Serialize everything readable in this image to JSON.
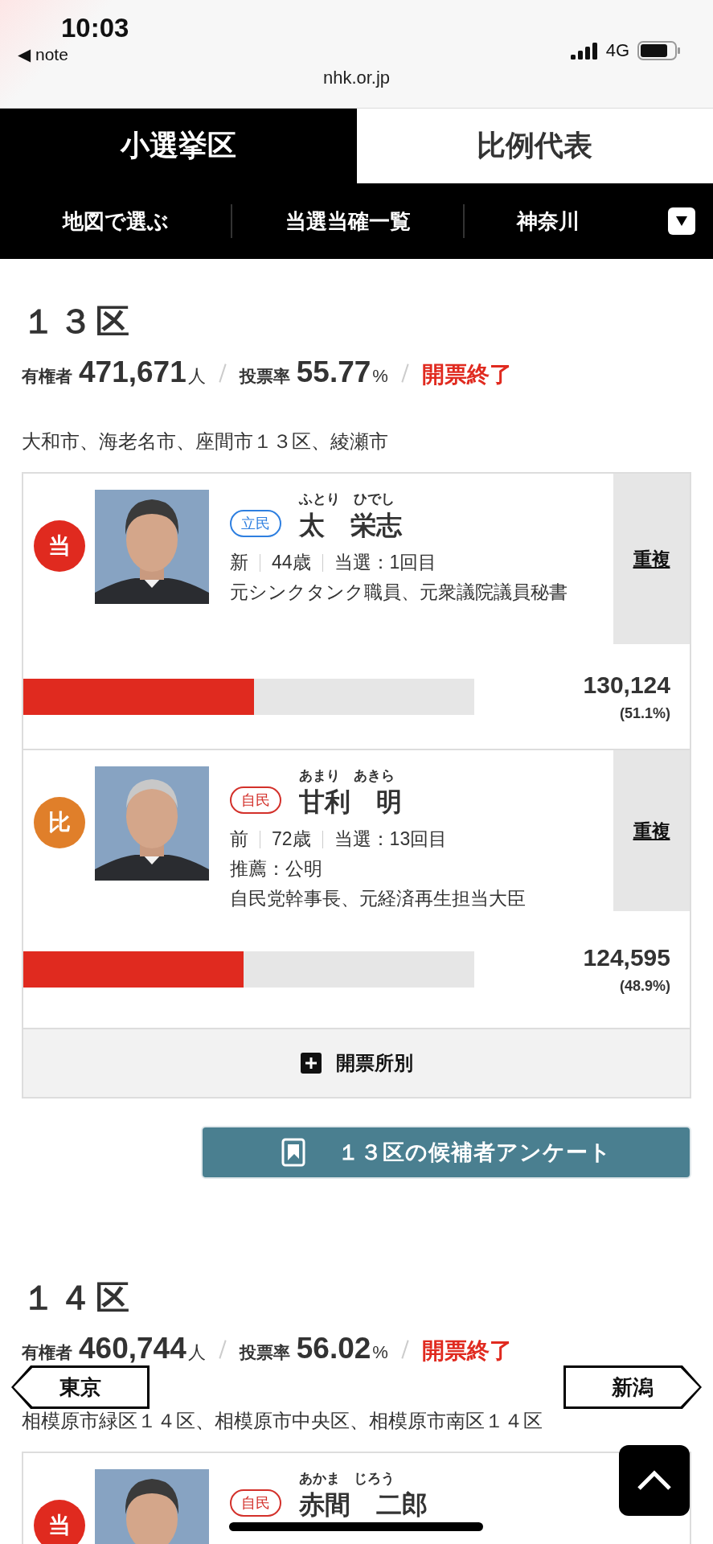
{
  "status_bar": {
    "time": "10:03",
    "back_app": "◀ note",
    "network": "4G",
    "url": "nhk.or.jp"
  },
  "tabs": [
    {
      "label": "小選挙区",
      "selected": true
    },
    {
      "label": "比例代表",
      "selected": false
    }
  ],
  "subnav": {
    "items": [
      "地図で選ぶ",
      "当選当確一覧"
    ],
    "prefecture": "神奈川"
  },
  "districts": [
    {
      "title": "１３区",
      "electorate_label": "有権者",
      "electorate": "471,671",
      "electorate_unit": "人",
      "turnout_label": "投票率",
      "turnout": "55.77",
      "turnout_unit": "%",
      "status": "開票終了",
      "area": "大和市、海老名市、座間市１３区、綾瀬市",
      "candidates": [
        {
          "badge": {
            "label": "当",
            "kind": "elected"
          },
          "party": {
            "label": "立民",
            "color": "#2e7fe0"
          },
          "furigana": "ふとり　ひでし",
          "name": "太　栄志",
          "facts": [
            "新",
            "44歳",
            "当選：1回目"
          ],
          "notes": [
            "元シンクタンク職員、元衆議院議員秘書"
          ],
          "dual": "重複",
          "votes": "130,124",
          "share": "(51.1%)",
          "level": 0.511
        },
        {
          "badge": {
            "label": "比",
            "kind": "proportional"
          },
          "party": {
            "label": "自民",
            "color": "#d3302a"
          },
          "furigana": "あまり　あきら",
          "name": "甘利　明",
          "facts": [
            "前",
            "72歳",
            "当選：13回目"
          ],
          "notes": [
            "推薦：公明",
            "自民党幹事長、元経済再生担当大臣"
          ],
          "dual": "重複",
          "votes": "124,595",
          "share": "(48.9%)",
          "level": 0.489
        }
      ],
      "breakdown": "開票所別",
      "survey": "１３区の候補者アンケート"
    },
    {
      "title": "１４区",
      "electorate_label": "有権者",
      "electorate": "460,744",
      "electorate_unit": "人",
      "turnout_label": "投票率",
      "turnout": "56.02",
      "turnout_unit": "%",
      "status": "開票終了",
      "area": "相模原市緑区１４区、相模原市中央区、相模原市南区１４区",
      "candidates": [
        {
          "badge": {
            "label": "当",
            "kind": "elected"
          },
          "party": {
            "label": "自民",
            "color": "#d3302a"
          },
          "furigana": "あかま　じろう",
          "name": "赤間　二郎"
        }
      ]
    }
  ],
  "nav": {
    "prev": "東京",
    "next": "新潟"
  }
}
